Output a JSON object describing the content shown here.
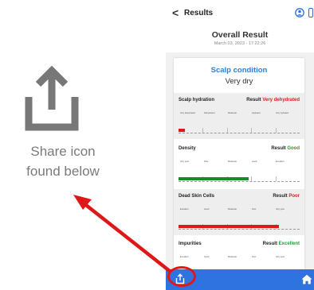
{
  "annotation": {
    "caption_line1": "Share icon",
    "caption_line2": "found below"
  },
  "app": {
    "back_symbol": "<",
    "title": "Results",
    "overall_title": "Overall Result",
    "date": "March 03, 2023 - 17:22:26",
    "scalp_condition_label": "Scalp condition",
    "scalp_condition_value": "Very dry"
  },
  "sections": [
    {
      "label": "Scalp hydration",
      "result_prefix": "Result",
      "result_value": "Very dehydrated",
      "result_color": "#e0181d",
      "fill_color": "#e0181d",
      "level": 0.05,
      "scale": [
        "Very dehydrated",
        "Dehydrated",
        "Moderate",
        "Hydrated",
        "Very hydrated"
      ]
    },
    {
      "label": "Density",
      "result_prefix": "Result",
      "result_value": "Good",
      "result_color": "#1f9e2b",
      "fill_color": "#1e8a1e",
      "level": 0.58,
      "scale": [
        "Very poor",
        "Poor",
        "Moderate",
        "Good",
        "Excellent"
      ]
    },
    {
      "label": "Dead Skin Cells",
      "result_prefix": "Result",
      "result_value": "Poor",
      "result_color": "#e0181d",
      "fill_color": "#e0181d",
      "level": 0.83,
      "scale": [
        "Excellent",
        "Good",
        "Moderate",
        "Poor",
        "Very poor"
      ]
    },
    {
      "label": "Impurities",
      "result_prefix": "Result",
      "result_value": "Excellent",
      "result_color": "#1f9e2b",
      "fill_color": "#1e8a1e",
      "level": 0.1,
      "scale": [
        "Excellent",
        "Good",
        "Moderate",
        "Poor",
        "Very poor"
      ]
    }
  ],
  "icons": {
    "share": "share-icon",
    "home": "home-icon",
    "user": "user-icon",
    "battery": "battery-icon"
  }
}
